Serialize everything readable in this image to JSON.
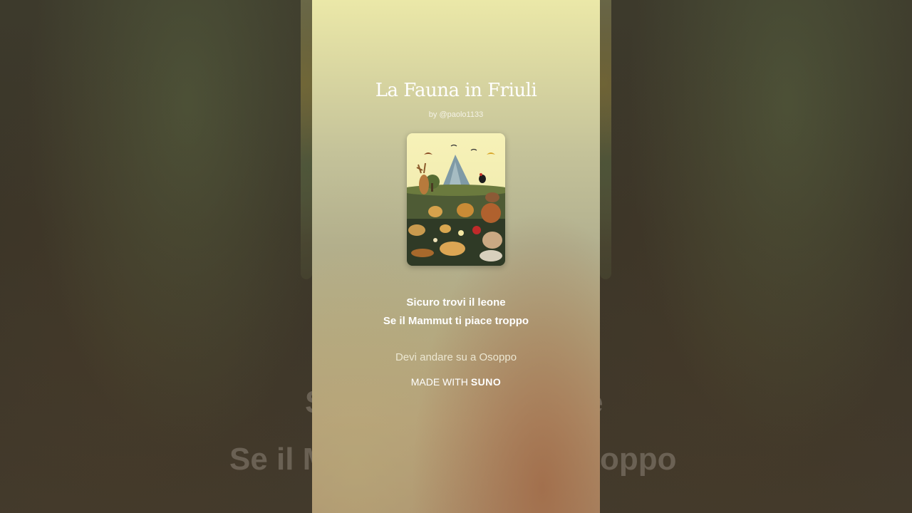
{
  "song": {
    "title": "La Fauna in Friuli",
    "artist": "by @paolo1133"
  },
  "lyrics": {
    "current_line_1": "Sicuro trovi il leone",
    "current_line_2": "Se il Mammut ti piace troppo",
    "next_line": "Devi andare su a Osoppo"
  },
  "footer": {
    "made_with": "MADE WITH",
    "brand": "SUNO"
  },
  "background": {
    "lyric_fragment_1": "S",
    "lyric_fragment_2": "e",
    "lyric_fragment_3": "Se il M",
    "lyric_fragment_4": "oppo"
  }
}
